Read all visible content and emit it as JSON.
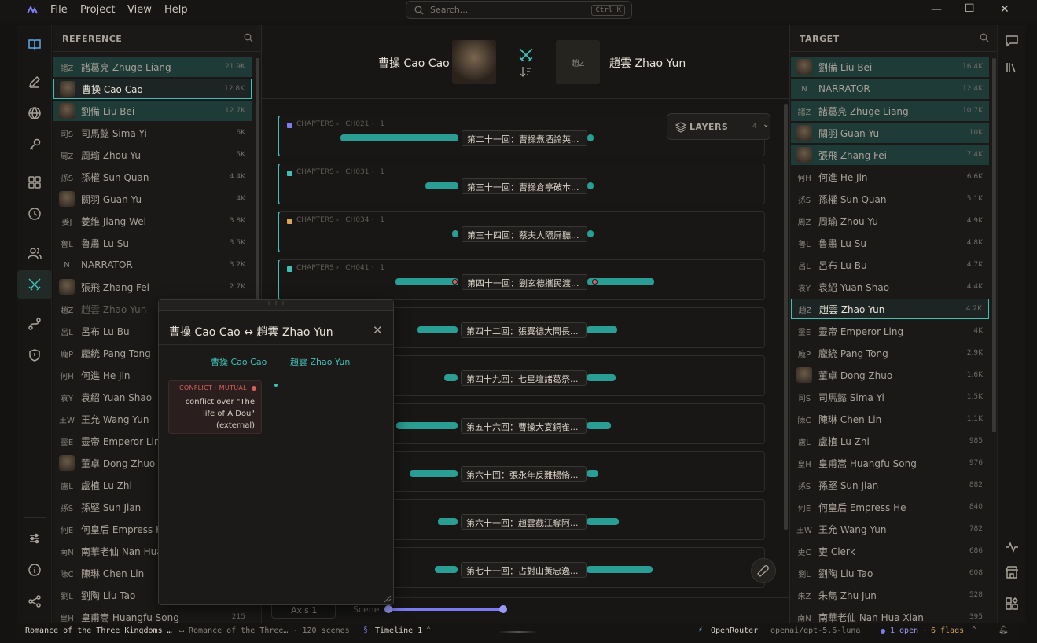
{
  "menu": {
    "file": "File",
    "project": "Project",
    "view": "View",
    "help": "Help"
  },
  "search": {
    "placeholder": "Search...",
    "shortcut": "Ctrl K"
  },
  "reference": {
    "title": "REFERENCE",
    "items": [
      {
        "abbr": "諸Z",
        "name": "諸葛亮 Zhuge Liang",
        "count": "21.9K",
        "state": "hl"
      },
      {
        "abbr": "",
        "name": "曹操 Cao Cao",
        "count": "12.8K",
        "state": "sel",
        "img": true
      },
      {
        "abbr": "",
        "name": "劉備 Liu Bei",
        "count": "12.7K",
        "state": "hl",
        "img": true
      },
      {
        "abbr": "司S",
        "name": "司馬懿 Sima Yi",
        "count": "6K",
        "state": ""
      },
      {
        "abbr": "周Z",
        "name": "周瑜 Zhou Yu",
        "count": "5K",
        "state": ""
      },
      {
        "abbr": "孫S",
        "name": "孫權 Sun Quan",
        "count": "4.4K",
        "state": ""
      },
      {
        "abbr": "",
        "name": "關羽 Guan Yu",
        "count": "4K",
        "state": "",
        "img": true
      },
      {
        "abbr": "姜J",
        "name": "姜維 Jiang Wei",
        "count": "3.8K",
        "state": ""
      },
      {
        "abbr": "魯L",
        "name": "魯肅 Lu Su",
        "count": "3.5K",
        "state": ""
      },
      {
        "abbr": "N",
        "name": "NARRATOR",
        "count": "3.2K",
        "state": ""
      },
      {
        "abbr": "",
        "name": "張飛 Zhang Fei",
        "count": "2.7K",
        "state": "",
        "img": true
      },
      {
        "abbr": "趙Z",
        "name": "趙雲 Zhao Yun",
        "count": "",
        "state": "dim"
      },
      {
        "abbr": "呂L",
        "name": "呂布 Lu Bu",
        "count": "",
        "state": ""
      },
      {
        "abbr": "龐P",
        "name": "龐統 Pang Tong",
        "count": "",
        "state": ""
      },
      {
        "abbr": "何H",
        "name": "何進 He Jin",
        "count": "",
        "state": ""
      },
      {
        "abbr": "袁Y",
        "name": "袁紹 Yuan Shao",
        "count": "",
        "state": ""
      },
      {
        "abbr": "王W",
        "name": "王允 Wang Yun",
        "count": "",
        "state": ""
      },
      {
        "abbr": "靈E",
        "name": "靈帝 Emperor Ling",
        "count": "",
        "state": ""
      },
      {
        "abbr": "",
        "name": "董卓 Dong Zhuo",
        "count": "",
        "state": "",
        "img": true
      },
      {
        "abbr": "盧L",
        "name": "盧植 Lu Zhi",
        "count": "",
        "state": ""
      },
      {
        "abbr": "孫S",
        "name": "孫堅 Sun Jian",
        "count": "",
        "state": ""
      },
      {
        "abbr": "何E",
        "name": "何皇后 Empress He",
        "count": "",
        "state": ""
      },
      {
        "abbr": "南N",
        "name": "南華老仙 Nan Hua",
        "count": "",
        "state": ""
      },
      {
        "abbr": "陳C",
        "name": "陳琳 Chen Lin",
        "count": "",
        "state": ""
      },
      {
        "abbr": "劉L",
        "name": "劉陶 Liu Tao",
        "count": "",
        "state": ""
      },
      {
        "abbr": "皇H",
        "name": "皇甫嵩 Huangfu Song",
        "count": "215",
        "state": ""
      }
    ]
  },
  "target": {
    "title": "TARGET",
    "items": [
      {
        "abbr": "",
        "name": "劉備 Liu Bei",
        "count": "16.4K",
        "state": "hl",
        "img": true
      },
      {
        "abbr": "N",
        "name": "NARRATOR",
        "count": "12.4K",
        "state": "hl"
      },
      {
        "abbr": "諸Z",
        "name": "諸葛亮 Zhuge Liang",
        "count": "10.7K",
        "state": "hl"
      },
      {
        "abbr": "",
        "name": "關羽 Guan Yu",
        "count": "10K",
        "state": "hl",
        "img": true
      },
      {
        "abbr": "",
        "name": "張飛 Zhang Fei",
        "count": "7.4K",
        "state": "hl",
        "img": true
      },
      {
        "abbr": "何H",
        "name": "何進 He Jin",
        "count": "6.6K",
        "state": ""
      },
      {
        "abbr": "孫S",
        "name": "孫權 Sun Quan",
        "count": "5.1K",
        "state": ""
      },
      {
        "abbr": "周Z",
        "name": "周瑜 Zhou Yu",
        "count": "4.9K",
        "state": ""
      },
      {
        "abbr": "魯L",
        "name": "魯肅 Lu Su",
        "count": "4.8K",
        "state": ""
      },
      {
        "abbr": "呂L",
        "name": "呂布 Lu Bu",
        "count": "4.7K",
        "state": ""
      },
      {
        "abbr": "袁Y",
        "name": "袁紹 Yuan Shao",
        "count": "4.4K",
        "state": ""
      },
      {
        "abbr": "趙Z",
        "name": "趙雲 Zhao Yun",
        "count": "4.2K",
        "state": "sel"
      },
      {
        "abbr": "靈E",
        "name": "靈帝 Emperor Ling",
        "count": "4K",
        "state": ""
      },
      {
        "abbr": "龐P",
        "name": "龐統 Pang Tong",
        "count": "2.9K",
        "state": ""
      },
      {
        "abbr": "",
        "name": "董卓 Dong Zhuo",
        "count": "1.6K",
        "state": "",
        "img": true
      },
      {
        "abbr": "司S",
        "name": "司馬懿 Sima Yi",
        "count": "1.5K",
        "state": ""
      },
      {
        "abbr": "陳C",
        "name": "陳琳 Chen Lin",
        "count": "1.1K",
        "state": ""
      },
      {
        "abbr": "盧L",
        "name": "盧植 Lu Zhi",
        "count": "985",
        "state": ""
      },
      {
        "abbr": "皇H",
        "name": "皇甫嵩 Huangfu Song",
        "count": "976",
        "state": ""
      },
      {
        "abbr": "孫S",
        "name": "孫堅 Sun Jian",
        "count": "882",
        "state": ""
      },
      {
        "abbr": "何E",
        "name": "何皇后 Empress He",
        "count": "840",
        "state": ""
      },
      {
        "abbr": "王W",
        "name": "王允 Wang Yun",
        "count": "782",
        "state": ""
      },
      {
        "abbr": "吏C",
        "name": "吏 Clerk",
        "count": "686",
        "state": ""
      },
      {
        "abbr": "劉L",
        "name": "劉陶 Liu Tao",
        "count": "608",
        "state": ""
      },
      {
        "abbr": "朱Z",
        "name": "朱雋 Zhu Jun",
        "count": "528",
        "state": ""
      },
      {
        "abbr": "南N",
        "name": "南華老仙 Nan Hua Xian",
        "count": "395",
        "state": ""
      }
    ]
  },
  "pair": {
    "left": "曹操 Cao Cao",
    "right": "趙雲 Zhao Yun",
    "right_abbr": "趙Z"
  },
  "layers": {
    "label": "LAYERS",
    "count": "4"
  },
  "scenes": [
    {
      "meta": "CHAPTERS",
      "chap": "CH021",
      "n": "1",
      "color": "#7c7cf0",
      "title": "第二十一回：曹操煮酒論英..."
    },
    {
      "meta": "CHAPTERS",
      "chap": "CH031",
      "n": "1",
      "color": "#3fbfb5",
      "title": "第三十一回：曹操倉亭破本..."
    },
    {
      "meta": "CHAPTERS",
      "chap": "CH034",
      "n": "1",
      "color": "#d8a45a",
      "title": "第三十四回：蔡夫人隔屏聽..."
    },
    {
      "meta": "CHAPTERS",
      "chap": "CH041",
      "n": "1",
      "color": "#3fbfb5",
      "title": "第四十一回：劉玄德攜民渡..."
    },
    {
      "title": "第四十二回：張翼德大鬧長..."
    },
    {
      "title": "第四十九回：七星壇諸葛祭..."
    },
    {
      "title": "第五十六回：曹操大宴銅雀..."
    },
    {
      "title": "第六十回：張永年反難楊脩..."
    },
    {
      "title": "第六十一回：趙雲截江奪阿..."
    },
    {
      "title": "第七十一回：占對山黃忠逸..."
    }
  ],
  "popup": {
    "title": "曹操 Cao Cao ↔ 趙雲 Zhao Yun",
    "col_left": "曹操 Cao Cao",
    "col_right": "趙雲 Zhao Yun",
    "tag": "CONFLICT · MUTUAL",
    "desc": "conflict over \"The life of A Dou\" (external)"
  },
  "bottom": {
    "axis": "Axis 1",
    "scene": "Scene"
  },
  "status": {
    "project": "Romance of the Three Kingdoms …",
    "file": "Romance of the Three… · 120 scenes",
    "timeline": "Timeline 1",
    "provider": "OpenRouter",
    "model": "openai/gpt-5.6-luna",
    "open": "1 open",
    "flags": "6 flags"
  }
}
